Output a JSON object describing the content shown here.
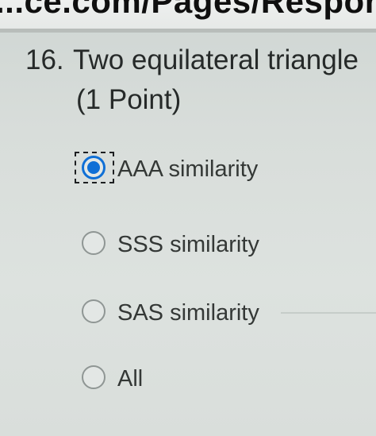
{
  "browser": {
    "url_fragment": "...ce.com/Pages/Response"
  },
  "question": {
    "number": "16.",
    "text": "Two equilateral triangle",
    "points": "(1 Point)"
  },
  "options": [
    {
      "label": "AAA similarity",
      "selected": true
    },
    {
      "label": "SSS similarity",
      "selected": false
    },
    {
      "label": "SAS similarity",
      "selected": false
    },
    {
      "label": "All",
      "selected": false
    }
  ],
  "colors": {
    "accent": "#0f6fd6",
    "text": "#262a29",
    "background": "#dde2df"
  }
}
